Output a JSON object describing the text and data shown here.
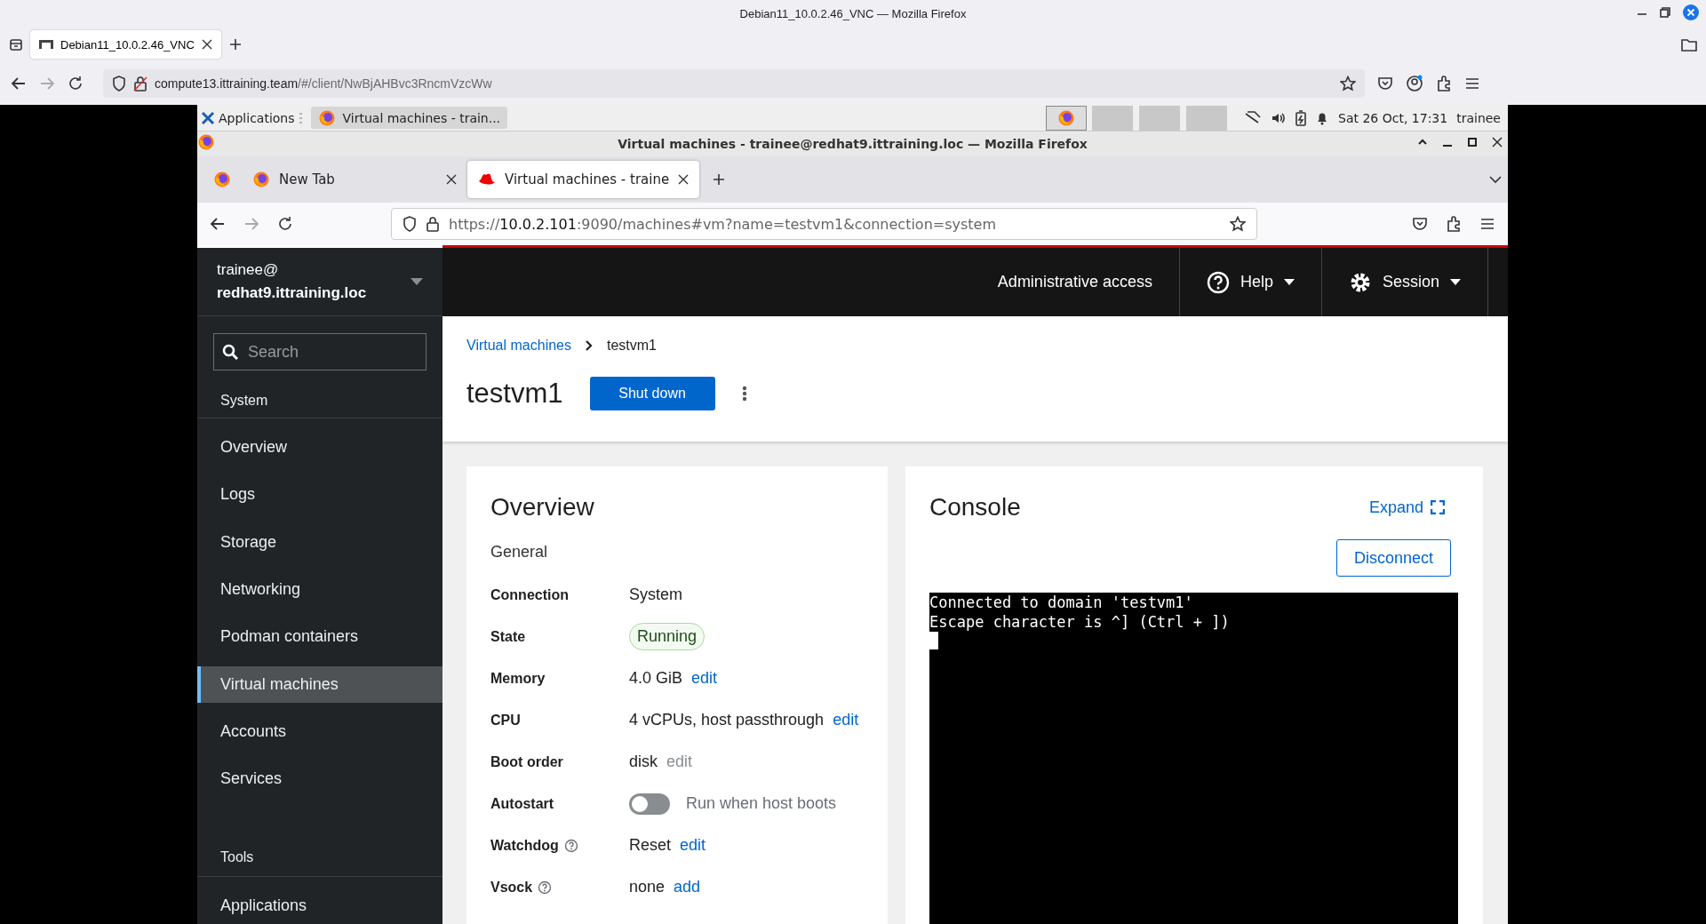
{
  "browser": {
    "window_title": "Debian11_10.0.2.46_VNC — Mozilla Firefox",
    "tabs": [
      {
        "label": "Debian11_10.0.2.46_VNC",
        "selected": true
      }
    ],
    "url": {
      "host": "compute13.ittraining.team",
      "path": "/#/client/NwBjAHBvc3RncmVzcWw"
    }
  },
  "remote": {
    "panel": {
      "applications": "Applications",
      "tasks": [
        {
          "label": "Virtual machines - train...",
          "selected": true
        }
      ],
      "clock": "Sat 26 Oct, 17:31",
      "user": "trainee"
    },
    "window_title": "Virtual machines - trainee@redhat9.ittraining.loc — Mozilla Firefox",
    "tabs": [
      {
        "label": "New Tab",
        "selected": false,
        "kind": "firefox"
      },
      {
        "label": "Virtual machines - traine",
        "selected": true,
        "kind": "redhat"
      }
    ],
    "url": {
      "scheme": "https://",
      "host": "10.0.2.101",
      "path": ":9090/machines#vm?name=testvm1&connection=system"
    },
    "cockpit": {
      "user": "trainee@",
      "host": "redhat9.ittraining.loc",
      "header": {
        "access": "Administrative access",
        "help": "Help",
        "session": "Session"
      },
      "search": {
        "placeholder": "Search"
      },
      "nav": [
        {
          "kind": "heading",
          "label": "System"
        },
        {
          "kind": "item",
          "label": "Overview",
          "selected": false
        },
        {
          "kind": "item",
          "label": "Logs",
          "selected": false
        },
        {
          "kind": "item",
          "label": "Storage",
          "selected": false
        },
        {
          "kind": "item",
          "label": "Networking",
          "selected": false
        },
        {
          "kind": "item",
          "label": "Podman containers",
          "selected": false
        },
        {
          "kind": "item",
          "label": "Virtual machines",
          "selected": true
        },
        {
          "kind": "item",
          "label": "Accounts",
          "selected": false
        },
        {
          "kind": "item",
          "label": "Services",
          "selected": false
        },
        {
          "kind": "heading",
          "label": "Tools"
        },
        {
          "kind": "item",
          "label": "Applications",
          "selected": false
        }
      ],
      "breadcrumb": [
        "Virtual machines",
        "testvm1"
      ],
      "title": "testvm1",
      "primary_button": "Shut down",
      "overview": {
        "title": "Overview",
        "section": "General",
        "rows": [
          {
            "kind": "text",
            "label": "Connection",
            "value": "System",
            "help": false
          },
          {
            "kind": "badge",
            "label": "State",
            "value": "Running",
            "help": false
          },
          {
            "kind": "text",
            "label": "Memory",
            "value": "4.0 GiB",
            "help": false,
            "action": {
              "label": "edit",
              "disabled": false
            }
          },
          {
            "kind": "text",
            "label": "CPU",
            "value": "4 vCPUs, host passthrough",
            "help": false,
            "action": {
              "label": "edit",
              "disabled": false
            }
          },
          {
            "kind": "text",
            "label": "Boot order",
            "value": "disk",
            "help": false,
            "action": {
              "label": "edit",
              "disabled": true
            }
          },
          {
            "kind": "toggle",
            "label": "Autostart",
            "value": "Run when host boots",
            "on": false,
            "help": false
          },
          {
            "kind": "text",
            "label": "Watchdog",
            "value": "Reset",
            "help": true,
            "action": {
              "label": "edit",
              "disabled": false
            }
          },
          {
            "kind": "text",
            "label": "Vsock",
            "value": "none",
            "help": true,
            "action": {
              "label": "add",
              "disabled": false
            }
          }
        ]
      },
      "console": {
        "title": "Console",
        "expand": "Expand",
        "button": "Disconnect",
        "lines": [
          "Connected to domain 'testvm1'",
          "Escape character is ^] (Ctrl + ])"
        ],
        "cursor": true
      }
    }
  }
}
